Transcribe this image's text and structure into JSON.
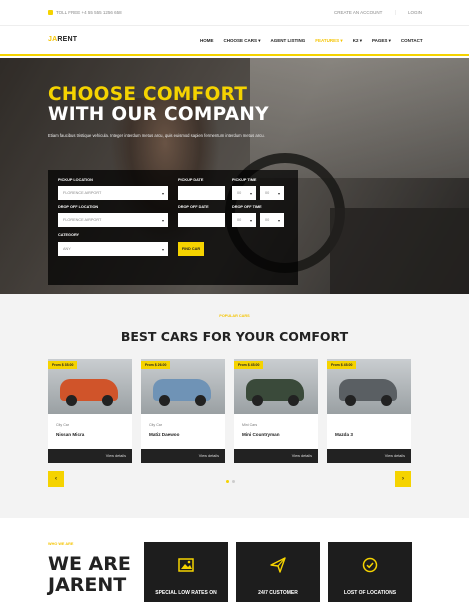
{
  "topbar": {
    "phone": "TOLL FREE +4 55 555 1256 658",
    "create_account": "CREATE AN ACCOUNT",
    "login": "LOGIN"
  },
  "logo": {
    "accent": "JA",
    "rest": "RENT"
  },
  "menu": [
    {
      "label": "HOME"
    },
    {
      "label": "CHOOSE CARS ▾"
    },
    {
      "label": "AGENT LISTING"
    },
    {
      "label": "FEATURES ▾",
      "active": true
    },
    {
      "label": "K2 ▾"
    },
    {
      "label": "PAGES ▾"
    },
    {
      "label": "CONTACT"
    }
  ],
  "hero": {
    "line1": "CHOOSE COMFORT",
    "line2": "WITH OUR COMPANY",
    "text": "Etiam faucibus tristique vehicula. Integer interdum metus arcu, quis euismod sapien fermentum interdum metus arcu."
  },
  "form": {
    "pickup_location_label": "PICKUP LOCATION",
    "pickup_location_value": "FLORENCE AIRPORT",
    "dropoff_location_label": "DROP OFF LOCATION",
    "dropoff_location_value": "FLORENCE AIRPORT",
    "category_label": "CATEGORY",
    "category_value": "ANY",
    "pickup_date_label": "PICKUP DATE",
    "pickup_time_label": "PICKUP TIME",
    "dropoff_date_label": "DROP OFF DATE",
    "dropoff_time_label": "DROP OFF TIME",
    "pickup_hour": "00",
    "pickup_min": "00",
    "dropoff_hour": "00",
    "dropoff_min": "00",
    "find_button": "FIND CAR"
  },
  "cars_section": {
    "small": "POPULAR CARS",
    "title": "BEST CARS FOR YOUR COMFORT",
    "view_details": "View details",
    "cards": [
      {
        "price": "From $ 35.00",
        "category": "City Car",
        "name": "Nissan Micra",
        "color": "#d0542a"
      },
      {
        "price": "From $ 26.00",
        "category": "City Car",
        "name": "Matiz Daewoo",
        "color": "#6f93b6"
      },
      {
        "price": "From $ 45.00",
        "category": "Mini Cars",
        "name": "Mini Countryman",
        "color": "#3a4a3a"
      },
      {
        "price": "From $ 45.00",
        "category": "",
        "name": "Mazda 3",
        "color": "#5a5f63"
      }
    ],
    "prev": "‹",
    "next": "›"
  },
  "about_section": {
    "small": "WHO WE ARE",
    "title_line1": "WE ARE",
    "title_line2": "JARENT",
    "features": [
      {
        "icon": "image-icon",
        "label": "SPECIAL LOW RATES ON"
      },
      {
        "icon": "paper-plane-icon",
        "label": "24/7 CUSTOMER"
      },
      {
        "icon": "check-circle-icon",
        "label": "LOST OF LOCATIONS"
      }
    ]
  },
  "colors": {
    "accent": "#f5d300",
    "dark": "#1d1d1d"
  }
}
